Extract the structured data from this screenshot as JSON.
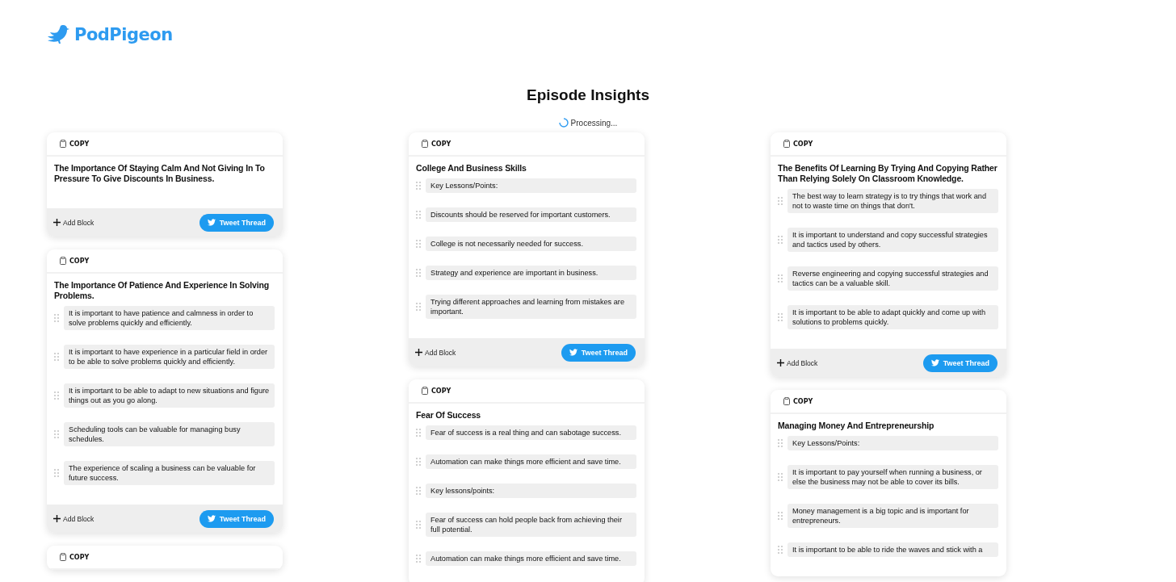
{
  "brand": "PodPigeon",
  "heading": "Episode Insights",
  "status": "Processing...",
  "columns": [
    {
      "cards": [
        {
          "copy": "COPY",
          "title": "The Importance Of Staying Calm And Not Giving In To Pressure To Give Discounts In Business.",
          "add": "Add Block",
          "tweet": "Tweet Thread"
        },
        {
          "copy": "COPY",
          "title": "The Importance Of Patience And Experience In Solving Problems.",
          "items": [
            "It is important to have patience and calmness in order to solve problems quickly and efficiently.",
            "It is important to have experience in a particular field in order to be able to solve problems quickly and efficiently.",
            "It is important to be able to adapt to new situations and figure things out as you go along.",
            "Scheduling tools can be valuable for managing busy schedules.",
            "The experience of scaling a business can be valuable for future success."
          ],
          "add": "Add Block",
          "tweet": "Tweet Thread"
        },
        {
          "copy": "COPY"
        }
      ]
    },
    {
      "cards": [
        {
          "copy": "COPY",
          "title": "College And Business Skills",
          "items": [
            "Key Lessons/Points:",
            "Discounts should be reserved for important customers.",
            "College is not necessarily needed for success.",
            "Strategy and experience are important in business.",
            "Trying different approaches and learning from mistakes are important."
          ],
          "add": "Add Block",
          "tweet": "Tweet Thread"
        },
        {
          "copy": "COPY",
          "title": "Fear Of Success",
          "items": [
            "Fear of success is a real thing and can sabotage success.",
            "Automation can make things more efficient and save time.",
            "Key lessons/points:",
            "Fear of success can hold people back from achieving their full potential.",
            "Automation can make things more efficient and save time."
          ]
        }
      ]
    },
    {
      "cards": [
        {
          "copy": "COPY",
          "title": "The Benefits Of Learning By Trying And Copying Rather Than Relying Solely On Classroom Knowledge.",
          "items": [
            "The best way to learn strategy is to try things that work and not to waste time on things that don't.",
            "It is important to understand and copy successful strategies and tactics used by others.",
            "Reverse engineering and copying successful strategies and tactics can be a valuable skill.",
            "It is important to be able to adapt quickly and come up with solutions to problems quickly."
          ],
          "add": "Add Block",
          "tweet": "Tweet Thread"
        },
        {
          "copy": "COPY",
          "title": "Managing Money And Entrepreneurship",
          "items": [
            "Key Lessons/Points:",
            "It is important to pay yourself when running a business, or else the business may not be able to cover its bills.",
            "Money management is a big topic and is important for entrepreneurs.",
            "It is important to be able to ride the waves and stick with a"
          ]
        }
      ]
    }
  ]
}
